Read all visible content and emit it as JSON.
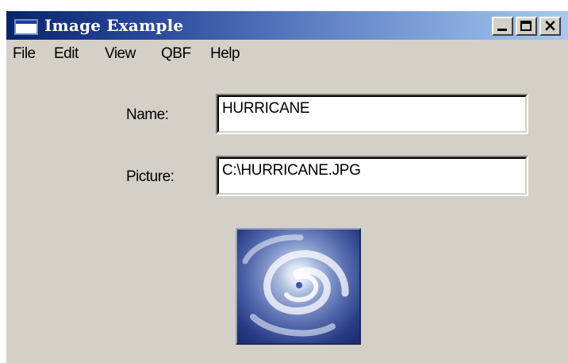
{
  "window": {
    "title": "Image Example",
    "controls": {
      "minimize": "minimize",
      "maximize": "maximize",
      "close": "×"
    }
  },
  "menu": {
    "items": [
      "File",
      "Edit",
      "View",
      "QBF",
      "Help"
    ]
  },
  "form": {
    "name_label": "Name:",
    "name_value": "HURRICANE",
    "picture_label": "Picture:",
    "picture_value": "C:\\HURRICANE.JPG"
  },
  "icons": {
    "app": "window-icon",
    "minimize": "minimize-icon",
    "maximize": "maximize-icon",
    "close": "close-icon"
  },
  "colors": {
    "titlebar_start": "#0a246a",
    "titlebar_end": "#a6caf0",
    "window_bg": "#d4d0c8"
  }
}
